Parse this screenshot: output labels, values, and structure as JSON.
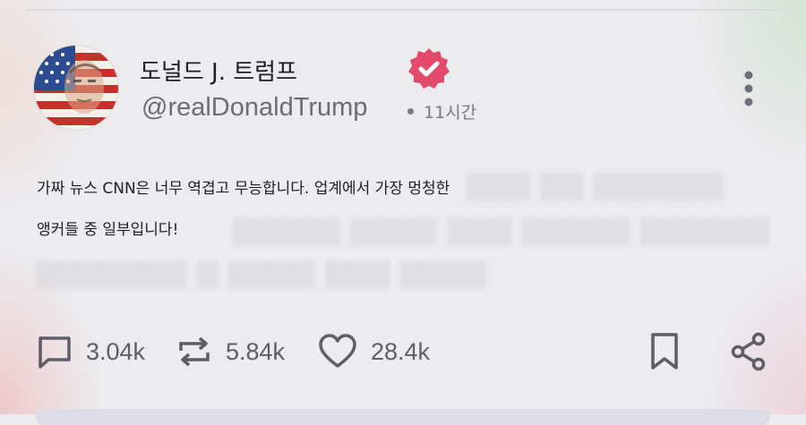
{
  "post": {
    "display_name": "도널드 J. 트럼프",
    "handle": "@realDonaldTrump",
    "time_ago": "11시간",
    "text_line1": "가짜 뉴스 CNN은 너무 역겹고 무능합니다. 업계에서 가장 멍청한",
    "text_line2": "앵커들 중 일부입니다!"
  },
  "actions": {
    "replies": "3.04k",
    "reposts": "5.84k",
    "likes": "28.4k"
  },
  "colors": {
    "verified_badge": "#e34a6a",
    "icon_gray": "#5e5c64",
    "text_dark": "#1f1f24"
  },
  "icons": [
    "more-vertical-icon",
    "reply-icon",
    "repost-icon",
    "heart-icon",
    "bookmark-icon",
    "share-icon",
    "verified-badge-icon"
  ]
}
